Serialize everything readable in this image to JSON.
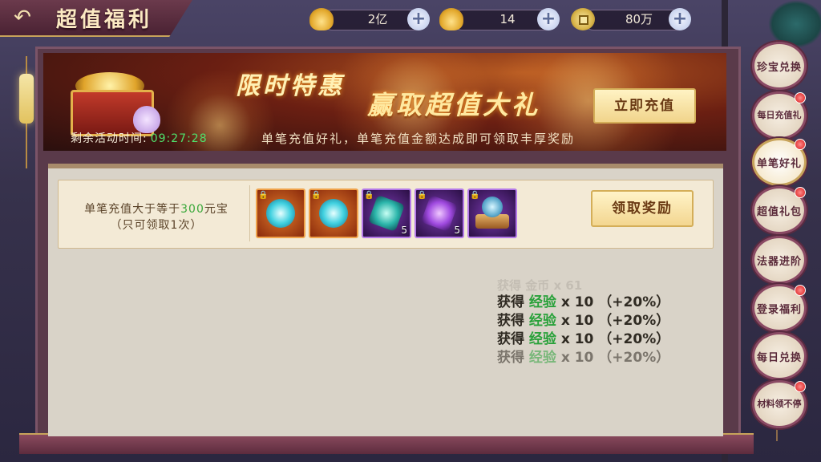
{
  "header": {
    "back_icon": "back-arrow-icon",
    "title": "超值福利"
  },
  "resources": [
    {
      "icon": "gold-ingot-icon",
      "value": "2亿"
    },
    {
      "icon": "locked-ingot-icon",
      "value": "14"
    },
    {
      "icon": "copper-coin-icon",
      "value": "80万"
    }
  ],
  "banner": {
    "promo_line1": "限时特惠",
    "promo_line2": "赢取超值大礼",
    "recharge_button": "立即充值",
    "timer_label": "剩余活动时间:",
    "timer_value": "09:27:28",
    "description": "单笔充值好礼，单笔充值金额达成即可领取丰厚奖励"
  },
  "task": {
    "condition_prefix": "单笔充值大于等于",
    "condition_amount": "300",
    "condition_suffix": "元宝",
    "limit": "（只可领取1次）",
    "claim_button": "领取奖励",
    "rewards": [
      {
        "icon": "cyan-rune-orb-icon",
        "frame": "orange",
        "count": ""
      },
      {
        "icon": "cyan-rune-orb-icon",
        "frame": "orange",
        "count": ""
      },
      {
        "icon": "teal-crystal-icon",
        "frame": "purple",
        "count": "5"
      },
      {
        "icon": "violet-crystal-icon",
        "frame": "purple",
        "count": "5"
      },
      {
        "icon": "orb-pedestal-icon",
        "frame": "purple",
        "count": ""
      }
    ]
  },
  "log": {
    "ghost_line": "获得 金币 x 61",
    "lines": [
      {
        "prefix": "获得 ",
        "item": "经验",
        "suffix": " x 10 （+20%）"
      },
      {
        "prefix": "获得 ",
        "item": "经验",
        "suffix": " x 10 （+20%）"
      },
      {
        "prefix": "获得 ",
        "item": "经验",
        "suffix": " x 10 （+20%）"
      },
      {
        "prefix": "获得 ",
        "item": "经验",
        "suffix": " x 10 （+20%）"
      }
    ]
  },
  "sidebar": [
    {
      "label": "珍宝兑换",
      "badge": false,
      "active": false
    },
    {
      "label": "每日充值礼",
      "badge": true,
      "active": false
    },
    {
      "label": "单笔好礼",
      "badge": true,
      "active": true
    },
    {
      "label": "超值礼包",
      "badge": true,
      "active": false
    },
    {
      "label": "法器进阶",
      "badge": false,
      "active": false
    },
    {
      "label": "登录福利",
      "badge": true,
      "active": false
    },
    {
      "label": "每日兑换",
      "badge": false,
      "active": false
    },
    {
      "label": "材料领不停",
      "badge": true,
      "active": false
    }
  ],
  "colors": {
    "highlight_green": "#3aa83a",
    "timer_green": "#4fe06b",
    "badge_red": "#d61a1a",
    "accent_gold": "#c7a35a"
  }
}
